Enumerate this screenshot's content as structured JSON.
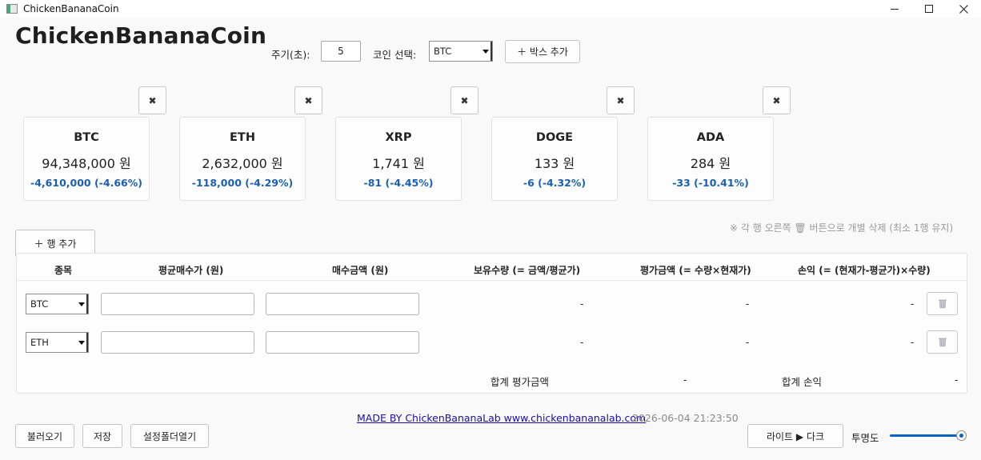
{
  "window": {
    "title": "ChickenBananaCoin"
  },
  "header": {
    "app_title": "ChickenBananaCoin",
    "period_label": "주기(초):",
    "period_value": "5",
    "coin_select_label": "코인 선택:",
    "coin_select_value": "BTC",
    "add_box_label": "＋ 박스 추가"
  },
  "cards": [
    {
      "symbol": "BTC",
      "price": "94,348,000 원",
      "change": "-4,610,000  (-4.66%)"
    },
    {
      "symbol": "ETH",
      "price": "2,632,000 원",
      "change": "-118,000  (-4.29%)"
    },
    {
      "symbol": "XRP",
      "price": "1,741 원",
      "change": "-81  (-4.45%)"
    },
    {
      "symbol": "DOGE",
      "price": "133 원",
      "change": "-6  (-4.32%)"
    },
    {
      "symbol": "ADA",
      "price": "284 원",
      "change": "-33  (-10.41%)"
    }
  ],
  "close_icon_glyph": "✖",
  "add_row_label": "＋ 행 추가",
  "hint": "※ 각 행 오른쪽 🗑 버튼으로 개별 삭제 (최소 1행 유지)",
  "table": {
    "headers": [
      "종목",
      "평균매수가 (원)",
      "매수금액 (원)",
      "보유수량 (= 금액/평균가)",
      "평가금액 (= 수량×현재가)",
      "손익 (= (현재가-평균가)×수량)"
    ],
    "rows": [
      {
        "coin": "BTC",
        "avg_price": "",
        "amount": "",
        "qty": "-",
        "value": "-",
        "pnl": "-"
      },
      {
        "coin": "ETH",
        "avg_price": "",
        "amount": "",
        "qty": "-",
        "value": "-",
        "pnl": "-"
      }
    ],
    "total_value_label": "합계 평가금액",
    "total_value": "-",
    "total_pnl_label": "합계 손익",
    "total_pnl": "-"
  },
  "footer": {
    "load_label": "불러오기",
    "save_label": "저장",
    "open_folder_label": "설정폴더열기",
    "credit_link": "MADE BY ChickenBananaLab www.chickenbananalab.com",
    "timestamp": "2026-06-04 21:23:50",
    "theme_toggle_label": "라이트 ▶ 다크",
    "opacity_label": "투명도",
    "opacity_value": 1.0
  },
  "colors": {
    "accent": "#0a64c8",
    "change_text": "#1b5fb4",
    "link": "#1a0dab"
  },
  "icons": {
    "close": "close-icon",
    "trash": "trash-icon"
  }
}
